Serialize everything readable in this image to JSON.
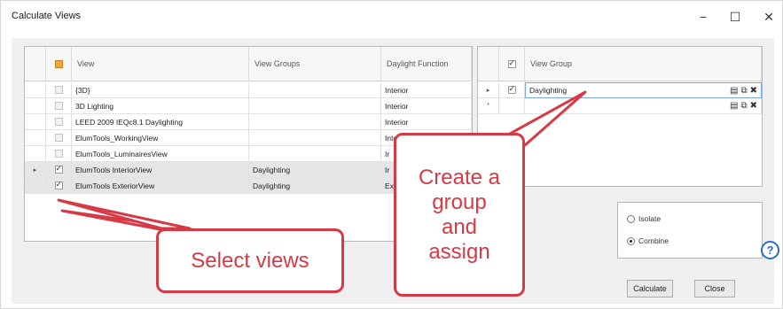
{
  "window": {
    "title": "Calculate Views",
    "minimize": "−",
    "maximize": "☐",
    "close": "✕"
  },
  "views_grid": {
    "columns": [
      "",
      "View",
      "View Groups",
      "Daylight Function"
    ],
    "rows": [
      {
        "indicator": "",
        "checked": false,
        "view": "{3D}",
        "group": "",
        "function": "Interior",
        "selected": false
      },
      {
        "indicator": "",
        "checked": false,
        "view": "3D Lighting",
        "group": "",
        "function": "Interior",
        "selected": false
      },
      {
        "indicator": "",
        "checked": false,
        "view": "LEED 2009 IEQc8.1 Daylighting",
        "group": "",
        "function": "Interior",
        "selected": false
      },
      {
        "indicator": "",
        "checked": false,
        "view": "ElumTools_WorkingView",
        "group": "",
        "function": "Interior",
        "selected": false
      },
      {
        "indicator": "",
        "checked": false,
        "view": "ElumTools_LuminairesView",
        "group": "",
        "function": "Ir",
        "selected": false
      },
      {
        "indicator": "▸",
        "checked": true,
        "view": "ElumTools InteriorView",
        "group": "Daylighting",
        "function": "Ir",
        "selected": true
      },
      {
        "indicator": "",
        "checked": true,
        "view": "ElumTools ExteriorView",
        "group": "Daylighting",
        "function": "Ex",
        "selected": true
      }
    ]
  },
  "groups_grid": {
    "columns": [
      "",
      "View Group"
    ],
    "rows": [
      {
        "indicator": "▸",
        "checked": true,
        "name": "Daylighting"
      },
      {
        "indicator": "*",
        "checked": false,
        "name": ""
      }
    ]
  },
  "options": {
    "isolate_label": "Isolate",
    "combine_label": "Combine",
    "selected": "Combine"
  },
  "buttons": {
    "calculate": "Calculate",
    "close": "Close",
    "help": "?"
  },
  "callouts": {
    "select_views": "Select views",
    "create_group_lines": [
      "Create a",
      "group",
      "and",
      "assign"
    ]
  },
  "colors": {
    "callout": "#d63a45",
    "header_checkbox": "#f2a43a",
    "help": "#2b6cc4"
  }
}
